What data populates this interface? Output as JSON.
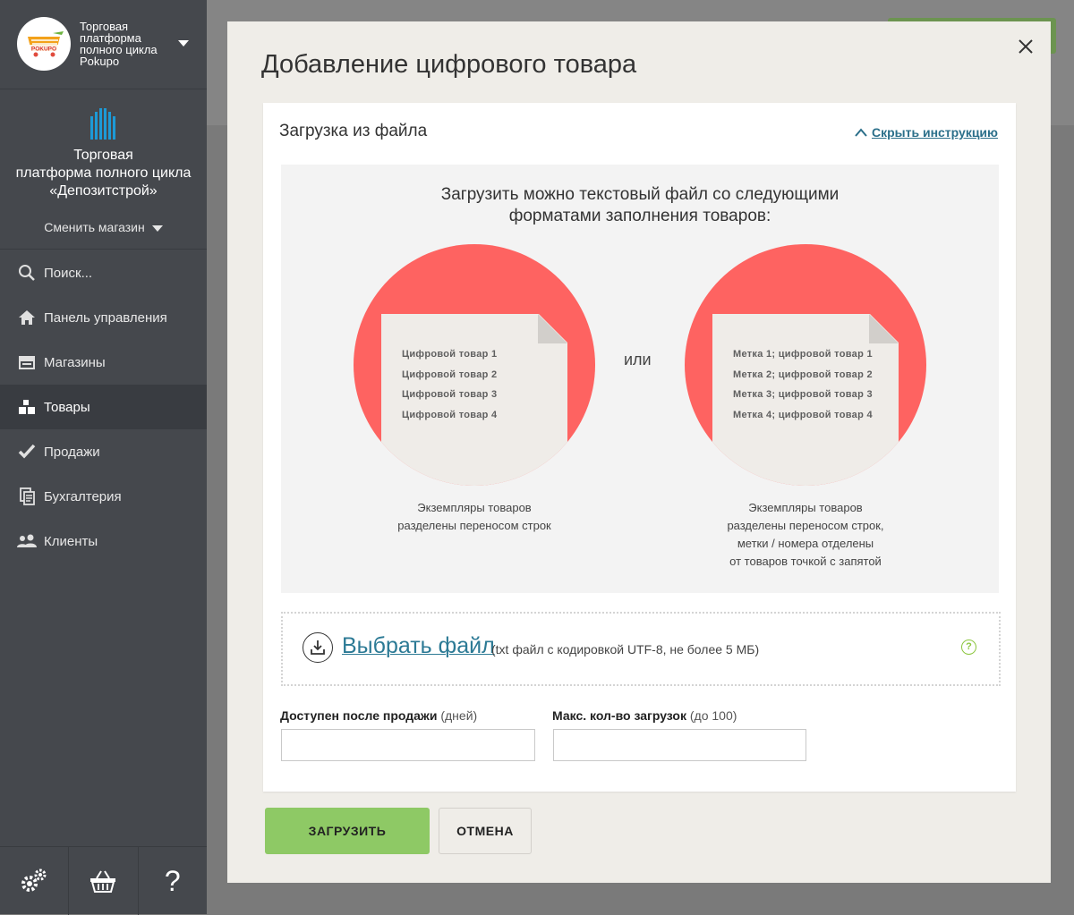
{
  "sidebar": {
    "store_name": "Торговая платформа полного цикла Pokupo",
    "logo_text": "POKUPO",
    "company_name_line1": "Торговая",
    "company_name_line2": "платформа полного цикла",
    "company_name_line3": "«Депозитстрой»",
    "switch_store": "Сменить магазин",
    "items": [
      {
        "label": "Поиск...",
        "icon": "search-icon"
      },
      {
        "label": "Панель управления",
        "icon": "home-icon"
      },
      {
        "label": "Магазины",
        "icon": "store-icon"
      },
      {
        "label": "Товары",
        "icon": "boxes-icon",
        "active": true
      },
      {
        "label": "Продажи",
        "icon": "check-icon"
      },
      {
        "label": "Бухгалтерия",
        "icon": "documents-icon"
      },
      {
        "label": "Клиенты",
        "icon": "users-icon"
      }
    ],
    "bottom": [
      {
        "icon": "gears-icon"
      },
      {
        "icon": "basket-icon"
      },
      {
        "icon": "question-icon",
        "label": "?"
      }
    ]
  },
  "modal": {
    "title": "Добавление цифрового товара",
    "card_title": "Загрузка из файла",
    "hide_instruction": "Скрыть инструкцию",
    "instruction": {
      "heading_line1": "Загрузить можно текстовый файл со следующими",
      "heading_line2": "форматами заполнения товаров:",
      "or": "или",
      "left_sheet": [
        "Цифровой товар 1",
        "Цифровой товар 2",
        "Цифровой товар 3",
        "Цифровой товар 4"
      ],
      "right_sheet": [
        "Метка 1; цифровой товар 1",
        "Метка 2; цифровой товар 2",
        "Метка 3; цифровой товар 3",
        "Метка 4; цифровой товар 4"
      ],
      "left_caption": [
        "Экземпляры товаров",
        "разделены переносом строк"
      ],
      "right_caption": [
        "Экземпляры товаров",
        "разделены переносом строк,",
        "метки / номера отделены",
        "от товаров точкой с запятой"
      ]
    },
    "choose_file": "Выбрать файл",
    "file_hint": "(txt файл с кодировкой UTF-8, не более 5 МБ)",
    "help": "?",
    "field1_label": "Доступен после продажи",
    "field1_hint": "(дней)",
    "field1_value": "",
    "field2_label": "Макс. кол-во загрузок",
    "field2_hint": "(до 100)",
    "field2_value": "",
    "upload_button": "ЗАГРУЗИТЬ",
    "cancel_button": "ОТМЕНА"
  },
  "colors": {
    "sidebar_bg": "#45484d",
    "accent_link": "#2c7a95",
    "circle_red": "#fe6361",
    "upload_green": "#8ec965"
  }
}
